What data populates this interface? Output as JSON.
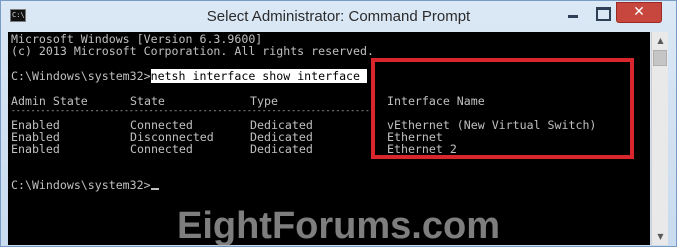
{
  "window": {
    "title": "Select Administrator: Command Prompt",
    "icon_text": "C:\\",
    "close_glyph": "✕"
  },
  "console": {
    "lines": [
      "Microsoft Windows [Version 6.3.9600]",
      "(c) 2013 Microsoft Corporation. All rights reserved."
    ],
    "prompt1": "C:\\Windows\\system32>",
    "command": "netsh interface show interface ",
    "headers": {
      "admin_state": "Admin State",
      "state": "State",
      "type": "Type",
      "interface_name": "Interface Name"
    },
    "divider": "-------------------------------------------------------------------------",
    "rows": [
      {
        "admin_state": "Enabled",
        "state": "Connected",
        "type": "Dedicated",
        "interface_name": "vEthernet (New Virtual Switch)"
      },
      {
        "admin_state": "Enabled",
        "state": "Disconnected",
        "type": "Dedicated",
        "interface_name": "Ethernet"
      },
      {
        "admin_state": "Enabled",
        "state": "Connected",
        "type": "Dedicated",
        "interface_name": "Ethernet 2"
      }
    ],
    "prompt2": "C:\\Windows\\system32>"
  },
  "highlight_color": "#d9262c",
  "watermark": "EightForums.com"
}
